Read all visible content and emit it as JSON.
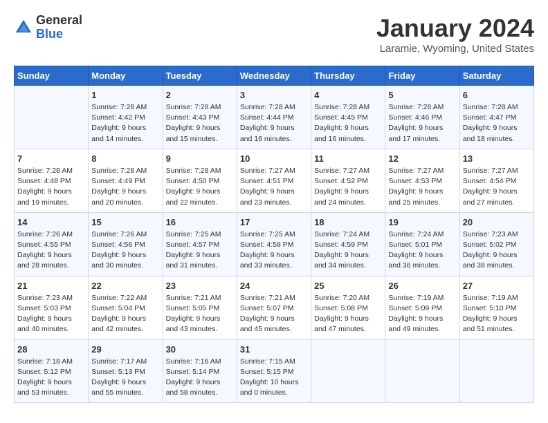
{
  "header": {
    "logo_general": "General",
    "logo_blue": "Blue",
    "month_title": "January 2024",
    "location": "Laramie, Wyoming, United States"
  },
  "calendar": {
    "days_of_week": [
      "Sunday",
      "Monday",
      "Tuesday",
      "Wednesday",
      "Thursday",
      "Friday",
      "Saturday"
    ],
    "weeks": [
      [
        {
          "day": "",
          "info": ""
        },
        {
          "day": "1",
          "info": "Sunrise: 7:28 AM\nSunset: 4:42 PM\nDaylight: 9 hours\nand 14 minutes."
        },
        {
          "day": "2",
          "info": "Sunrise: 7:28 AM\nSunset: 4:43 PM\nDaylight: 9 hours\nand 15 minutes."
        },
        {
          "day": "3",
          "info": "Sunrise: 7:28 AM\nSunset: 4:44 PM\nDaylight: 9 hours\nand 16 minutes."
        },
        {
          "day": "4",
          "info": "Sunrise: 7:28 AM\nSunset: 4:45 PM\nDaylight: 9 hours\nand 16 minutes."
        },
        {
          "day": "5",
          "info": "Sunrise: 7:28 AM\nSunset: 4:46 PM\nDaylight: 9 hours\nand 17 minutes."
        },
        {
          "day": "6",
          "info": "Sunrise: 7:28 AM\nSunset: 4:47 PM\nDaylight: 9 hours\nand 18 minutes."
        }
      ],
      [
        {
          "day": "7",
          "info": "Sunrise: 7:28 AM\nSunset: 4:48 PM\nDaylight: 9 hours\nand 19 minutes."
        },
        {
          "day": "8",
          "info": "Sunrise: 7:28 AM\nSunset: 4:49 PM\nDaylight: 9 hours\nand 20 minutes."
        },
        {
          "day": "9",
          "info": "Sunrise: 7:28 AM\nSunset: 4:50 PM\nDaylight: 9 hours\nand 22 minutes."
        },
        {
          "day": "10",
          "info": "Sunrise: 7:27 AM\nSunset: 4:51 PM\nDaylight: 9 hours\nand 23 minutes."
        },
        {
          "day": "11",
          "info": "Sunrise: 7:27 AM\nSunset: 4:52 PM\nDaylight: 9 hours\nand 24 minutes."
        },
        {
          "day": "12",
          "info": "Sunrise: 7:27 AM\nSunset: 4:53 PM\nDaylight: 9 hours\nand 25 minutes."
        },
        {
          "day": "13",
          "info": "Sunrise: 7:27 AM\nSunset: 4:54 PM\nDaylight: 9 hours\nand 27 minutes."
        }
      ],
      [
        {
          "day": "14",
          "info": "Sunrise: 7:26 AM\nSunset: 4:55 PM\nDaylight: 9 hours\nand 28 minutes."
        },
        {
          "day": "15",
          "info": "Sunrise: 7:26 AM\nSunset: 4:56 PM\nDaylight: 9 hours\nand 30 minutes."
        },
        {
          "day": "16",
          "info": "Sunrise: 7:25 AM\nSunset: 4:57 PM\nDaylight: 9 hours\nand 31 minutes."
        },
        {
          "day": "17",
          "info": "Sunrise: 7:25 AM\nSunset: 4:58 PM\nDaylight: 9 hours\nand 33 minutes."
        },
        {
          "day": "18",
          "info": "Sunrise: 7:24 AM\nSunset: 4:59 PM\nDaylight: 9 hours\nand 34 minutes."
        },
        {
          "day": "19",
          "info": "Sunrise: 7:24 AM\nSunset: 5:01 PM\nDaylight: 9 hours\nand 36 minutes."
        },
        {
          "day": "20",
          "info": "Sunrise: 7:23 AM\nSunset: 5:02 PM\nDaylight: 9 hours\nand 38 minutes."
        }
      ],
      [
        {
          "day": "21",
          "info": "Sunrise: 7:23 AM\nSunset: 5:03 PM\nDaylight: 9 hours\nand 40 minutes."
        },
        {
          "day": "22",
          "info": "Sunrise: 7:22 AM\nSunset: 5:04 PM\nDaylight: 9 hours\nand 42 minutes."
        },
        {
          "day": "23",
          "info": "Sunrise: 7:21 AM\nSunset: 5:05 PM\nDaylight: 9 hours\nand 43 minutes."
        },
        {
          "day": "24",
          "info": "Sunrise: 7:21 AM\nSunset: 5:07 PM\nDaylight: 9 hours\nand 45 minutes."
        },
        {
          "day": "25",
          "info": "Sunrise: 7:20 AM\nSunset: 5:08 PM\nDaylight: 9 hours\nand 47 minutes."
        },
        {
          "day": "26",
          "info": "Sunrise: 7:19 AM\nSunset: 5:09 PM\nDaylight: 9 hours\nand 49 minutes."
        },
        {
          "day": "27",
          "info": "Sunrise: 7:19 AM\nSunset: 5:10 PM\nDaylight: 9 hours\nand 51 minutes."
        }
      ],
      [
        {
          "day": "28",
          "info": "Sunrise: 7:18 AM\nSunset: 5:12 PM\nDaylight: 9 hours\nand 53 minutes."
        },
        {
          "day": "29",
          "info": "Sunrise: 7:17 AM\nSunset: 5:13 PM\nDaylight: 9 hours\nand 55 minutes."
        },
        {
          "day": "30",
          "info": "Sunrise: 7:16 AM\nSunset: 5:14 PM\nDaylight: 9 hours\nand 58 minutes."
        },
        {
          "day": "31",
          "info": "Sunrise: 7:15 AM\nSunset: 5:15 PM\nDaylight: 10 hours\nand 0 minutes."
        },
        {
          "day": "",
          "info": ""
        },
        {
          "day": "",
          "info": ""
        },
        {
          "day": "",
          "info": ""
        }
      ]
    ]
  }
}
